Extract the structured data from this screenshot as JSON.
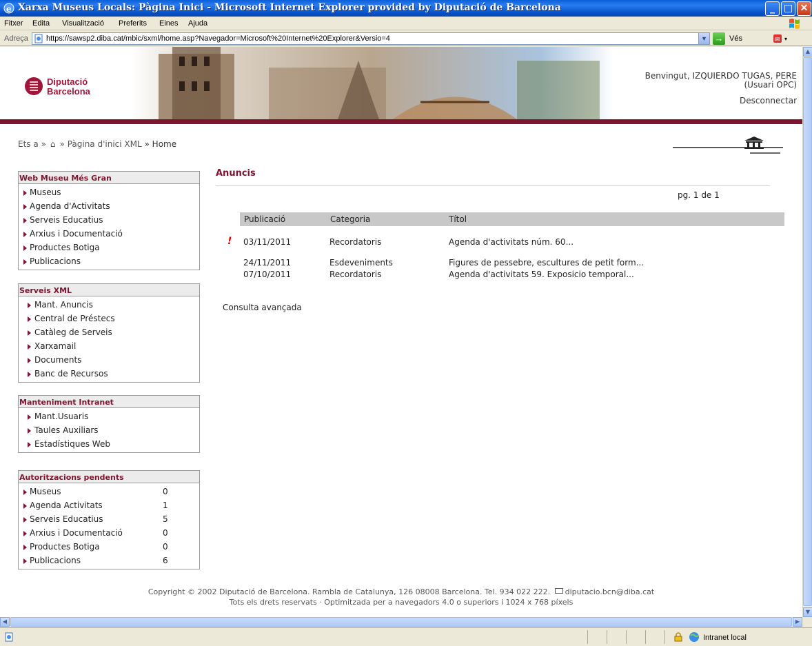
{
  "window": {
    "title": "Xarxa Museus Locals: Pàgina Inici - Microsoft Internet Explorer provided by Diputació de Barcelona"
  },
  "menubar": {
    "items": [
      "Fitxer",
      "Edita",
      "Visualització",
      "Preferits",
      "Eines",
      "Ajuda"
    ]
  },
  "addressbar": {
    "label": "Adreça",
    "url": "https://sawsp2.diba.cat/mbic/sxml/home.asp?Navegador=Microsoft%20Internet%20Explorer&Versio=4",
    "go_label": "Vés"
  },
  "header": {
    "logo_line1": "Diputació",
    "logo_line2": "Barcelona",
    "welcome_user": "Benvingut, IZQUIERDO TUGAS, PERE",
    "welcome_role": "(Usuari OPC)",
    "logout": "Desconnectar"
  },
  "breadcrumb": {
    "prefix": "Ets a »",
    "sep": "»",
    "item1": "Pàgina d'inici XML",
    "item2": "» Home"
  },
  "sidebar": {
    "web_museu": {
      "title": "Web Museu Més Gran",
      "items": [
        "Museus",
        "Agenda d'Activitats",
        "Serveis Educatius",
        "Arxius i Documentació",
        "Productes Botiga",
        "Publicacions"
      ]
    },
    "serveis_xml": {
      "title": "Serveis XML",
      "items": [
        "Mant. Anuncis",
        "Central de Préstecs",
        "Catàleg de Serveis",
        "Xarxamail",
        "Documents",
        "Banc de Recursos"
      ]
    },
    "manteniment": {
      "title": "Manteniment Intranet",
      "items": [
        "Mant.Usuaris",
        "Taules Auxiliars",
        "Estadístiques Web"
      ]
    },
    "autoritzacions": {
      "title": "Autoritzacions pendents",
      "items": [
        {
          "label": "Museus",
          "count": "0"
        },
        {
          "label": "Agenda Activitats",
          "count": "1"
        },
        {
          "label": "Serveis Educatius",
          "count": "5"
        },
        {
          "label": "Arxius i Documentació",
          "count": "0"
        },
        {
          "label": "Productes Botiga",
          "count": "0"
        },
        {
          "label": "Publicacions",
          "count": "6"
        }
      ]
    }
  },
  "main": {
    "title": "Anuncis",
    "pager": "pg. 1 de 1",
    "columns": [
      "Publicació",
      "Categoria",
      "Títol"
    ],
    "rows": [
      {
        "flag": "!",
        "date": "03/11/2011",
        "category": "Recordatoris",
        "title": "Agenda d'activitats núm. 60..."
      },
      {
        "flag": "",
        "date": "24/11/2011",
        "category": "Esdeveniments",
        "title": "Figures de pessebre, escultures de petit form..."
      },
      {
        "flag": "",
        "date": "07/10/2011",
        "category": "Recordatoris",
        "title": "Agenda d'activitats 59. Exposicio temporal..."
      }
    ],
    "advanced_search": "Consulta avançada"
  },
  "footer": {
    "line1a": "Copyright © 2002 Diputació de Barcelona. Rambla de Catalunya, 126 08008 Barcelona. Tel. 934 022 222.",
    "email": "diputacio.bcn@diba.cat",
    "line2": "Tots els drets reservats · Optimitzada per a navegadors 4.0 o superiors i 1024 x 768 píxels"
  },
  "statusbar": {
    "zone": "Intranet local"
  },
  "colors": {
    "brand": "#7d1531",
    "xp_title": "#0a5fd8"
  },
  "icons": [
    "ie-icon",
    "minimize-icon",
    "maximize-icon",
    "close-icon",
    "windows-logo-icon",
    "page-icon",
    "go-arrow-icon",
    "home-icon",
    "lock-icon",
    "globe-icon",
    "envelope-icon",
    "warning-flag-icon"
  ]
}
